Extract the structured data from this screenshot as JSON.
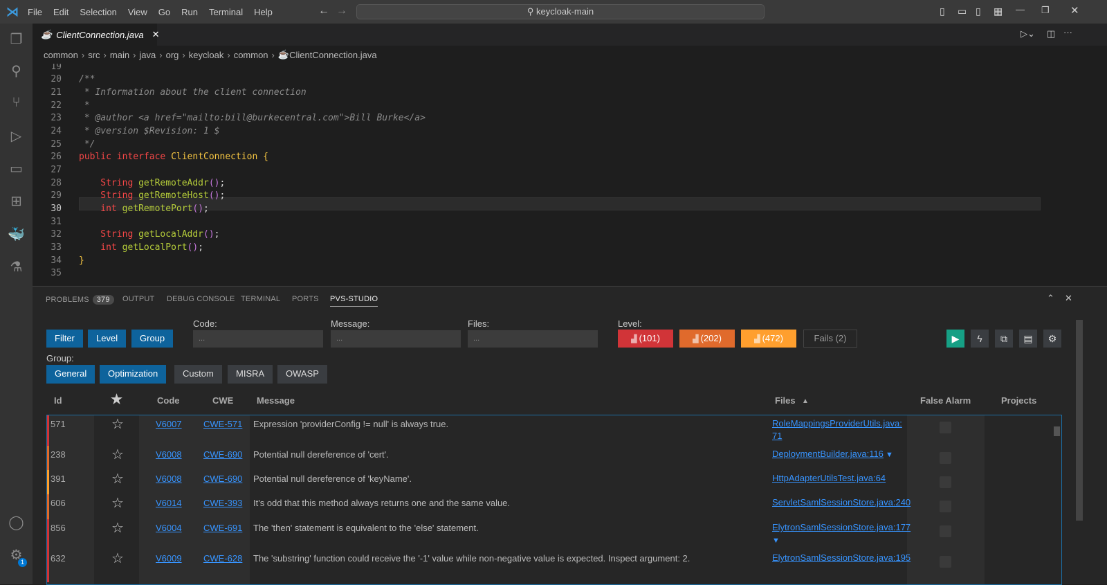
{
  "titlebar": {
    "menu": [
      "File",
      "Edit",
      "Selection",
      "View",
      "Go",
      "Run",
      "Terminal",
      "Help"
    ],
    "search": "keycloak-main"
  },
  "tab": {
    "label": "ClientConnection.java",
    "close": "✕"
  },
  "breadcrumbs": [
    "common",
    "src",
    "main",
    "java",
    "org",
    "keycloak",
    "common",
    "ClientConnection.java"
  ],
  "editor": {
    "current_line": 30,
    "lines": [
      {
        "n": "19",
        "t": []
      },
      {
        "n": "20",
        "t": [
          [
            "cmt",
            "/**"
          ]
        ]
      },
      {
        "n": "21",
        "t": [
          [
            "cmt",
            " * Information about the client connection"
          ]
        ]
      },
      {
        "n": "22",
        "t": [
          [
            "cmt",
            " *"
          ]
        ]
      },
      {
        "n": "23",
        "t": [
          [
            "cmt",
            " * @author <a href=\"mailto:bill@burkecentral.com\">Bill Burke</a>"
          ]
        ]
      },
      {
        "n": "24",
        "t": [
          [
            "cmt",
            " * @version $Revision: 1 $"
          ]
        ]
      },
      {
        "n": "25",
        "t": [
          [
            "cmt",
            " */"
          ]
        ]
      },
      {
        "n": "26",
        "t": [
          [
            "kw",
            "public interface "
          ],
          [
            "cls",
            "ClientConnection "
          ],
          [
            "cls",
            "{"
          ]
        ]
      },
      {
        "n": "27",
        "t": []
      },
      {
        "n": "28",
        "t": [
          [
            "ty",
            "    String "
          ],
          [
            "fn",
            "getRemoteAddr"
          ],
          [
            "par",
            "()"
          ],
          [
            "pun",
            ";"
          ]
        ]
      },
      {
        "n": "29",
        "t": [
          [
            "ty",
            "    String "
          ],
          [
            "fn",
            "getRemoteHost"
          ],
          [
            "par",
            "()"
          ],
          [
            "pun",
            ";"
          ]
        ]
      },
      {
        "n": "30",
        "t": [
          [
            "ty",
            "    int "
          ],
          [
            "fn",
            "getRemotePort"
          ],
          [
            "par",
            "()"
          ],
          [
            "pun",
            ";"
          ]
        ]
      },
      {
        "n": "31",
        "t": []
      },
      {
        "n": "32",
        "t": [
          [
            "ty",
            "    String "
          ],
          [
            "fn",
            "getLocalAddr"
          ],
          [
            "par",
            "()"
          ],
          [
            "pun",
            ";"
          ]
        ]
      },
      {
        "n": "33",
        "t": [
          [
            "ty",
            "    int "
          ],
          [
            "fn",
            "getLocalPort"
          ],
          [
            "par",
            "()"
          ],
          [
            "pun",
            ";"
          ]
        ]
      },
      {
        "n": "34",
        "t": [
          [
            "cls",
            "}"
          ]
        ]
      },
      {
        "n": "35",
        "t": []
      }
    ]
  },
  "panel": {
    "tabs": [
      "PROBLEMS",
      "OUTPUT",
      "DEBUG CONSOLE",
      "TERMINAL",
      "PORTS",
      "PVS-STUDIO"
    ],
    "problems_count": "379",
    "active_tab": "PVS-STUDIO"
  },
  "pvs": {
    "buttons": {
      "filter": "Filter",
      "level": "Level",
      "group": "Group"
    },
    "code_label": "Code:",
    "message_label": "Message:",
    "files_label": "Files:",
    "level_label": "Level:",
    "placeholder": "...",
    "levels": [
      {
        "label": "(101)",
        "color": "#d13438"
      },
      {
        "label": "(202)",
        "color": "#e06a2c"
      },
      {
        "label": "(472)",
        "color": "#ff9f2e"
      }
    ],
    "fails": "Fails (2)",
    "group_label": "Group:",
    "groups": [
      {
        "label": "General",
        "active": true
      },
      {
        "label": "Optimization",
        "active": true
      },
      {
        "label": "Custom",
        "active": false
      },
      {
        "label": "MISRA",
        "active": false
      },
      {
        "label": "OWASP",
        "active": false
      }
    ],
    "columns": {
      "id": "Id",
      "code": "Code",
      "cwe": "CWE",
      "message": "Message",
      "files": "Files",
      "false_alarm": "False Alarm",
      "projects": "Projects"
    },
    "rows": [
      {
        "id": "571",
        "code": "V6007",
        "cwe": "CWE-571",
        "message": "Expression 'providerConfig != null' is always true.",
        "file": "RoleMappingsProviderUtils.java:",
        "file2": "71",
        "level_color": "#d13438"
      },
      {
        "id": "238",
        "code": "V6008",
        "cwe": "CWE-690",
        "message": "Potential null dereference of 'cert'.",
        "file": "DeploymentBuilder.java:116",
        "expand": true,
        "level_color": "#e06a2c"
      },
      {
        "id": "391",
        "code": "V6008",
        "cwe": "CWE-690",
        "message": "Potential null dereference of 'keyName'.",
        "file": "HttpAdapterUtilsTest.java:64",
        "level_color": "#ff9f2e"
      },
      {
        "id": "606",
        "code": "V6014",
        "cwe": "CWE-393",
        "message": "It's odd that this method always returns one and the same value.",
        "file": "ServletSamlSessionStore.java:240",
        "level_color": "#e06a2c"
      },
      {
        "id": "856",
        "code": "V6004",
        "cwe": "CWE-691",
        "message": "The 'then' statement is equivalent to the 'else' statement.",
        "file": "ElytronSamlSessionStore.java:177",
        "expand2": true,
        "level_color": "#d13438"
      },
      {
        "id": "632",
        "code": "V6009",
        "cwe": "CWE-628",
        "message": "The 'substring' function could receive the '-1' value while non-negative value is expected. Inspect argument: 2.",
        "file": "ElytronSamlSessionStore.java:195",
        "level_color": "#d13438"
      }
    ]
  },
  "notifications_badge": "1"
}
